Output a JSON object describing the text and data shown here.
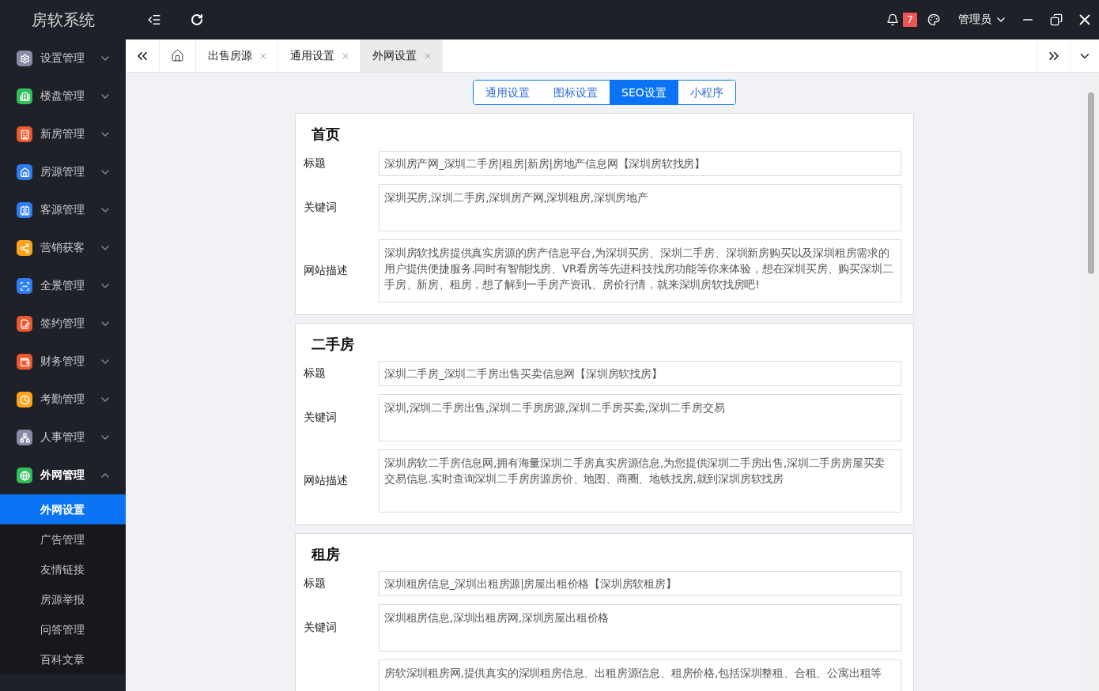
{
  "header": {
    "logo": "房软系统",
    "notification_count": "7",
    "user": "管理员"
  },
  "sidebar": {
    "items": [
      {
        "label": "设置管理",
        "color": "#8a8aa8",
        "expanded": false
      },
      {
        "label": "楼盘管理",
        "color": "#2fbf5b",
        "expanded": false
      },
      {
        "label": "新房管理",
        "color": "#f0572d",
        "expanded": false
      },
      {
        "label": "房源管理",
        "color": "#2f7df6",
        "expanded": false
      },
      {
        "label": "客源管理",
        "color": "#2f7df6",
        "expanded": false
      },
      {
        "label": "营销获客",
        "color": "#fba41c",
        "expanded": false
      },
      {
        "label": "全景管理",
        "color": "#2f7df6",
        "expanded": false
      },
      {
        "label": "签约管理",
        "color": "#f0572d",
        "expanded": false
      },
      {
        "label": "财务管理",
        "color": "#f0572d",
        "expanded": false
      },
      {
        "label": "考勤管理",
        "color": "#fba41c",
        "expanded": false
      },
      {
        "label": "人事管理",
        "color": "#8a8aa8",
        "expanded": false
      },
      {
        "label": "外网管理",
        "color": "#2fbf5b",
        "expanded": true,
        "children": [
          {
            "label": "外网设置",
            "selected": true
          },
          {
            "label": "广告管理",
            "selected": false
          },
          {
            "label": "友情链接",
            "selected": false
          },
          {
            "label": "房源举报",
            "selected": false
          },
          {
            "label": "问答管理",
            "selected": false
          },
          {
            "label": "百科文章",
            "selected": false
          }
        ]
      }
    ]
  },
  "tabs": [
    {
      "label": "出售房源",
      "selected": false
    },
    {
      "label": "通用设置",
      "selected": false
    },
    {
      "label": "外网设置",
      "selected": true
    }
  ],
  "segments": [
    {
      "label": "通用设置",
      "selected": false
    },
    {
      "label": "图标设置",
      "selected": false
    },
    {
      "label": "SEO设置",
      "selected": true
    },
    {
      "label": "小程序",
      "selected": false
    }
  ],
  "sections": [
    {
      "title": "首页",
      "fields": [
        {
          "kind": "input",
          "label": "标题",
          "value": "深圳房产网_深圳二手房|租房|新房|房地产信息网【深圳房软找房】"
        },
        {
          "kind": "keywords",
          "label": "关键词",
          "value": "深圳买房,深圳二手房,深圳房产网,深圳租房,深圳房地产"
        },
        {
          "kind": "description",
          "label": "网站描述",
          "value": "深圳房软找房提供真实房源的房产信息平台,为深圳买房、深圳二手房、深圳新房购买以及深圳租房需求的用户提供便捷服务.同时有智能找房、VR看房等先进科技找房功能等你来体验，想在深圳买房、购买深圳二手房、新房、租房，想了解到一手房产资讯、房价行情，就来深圳房软找房吧!"
        }
      ]
    },
    {
      "title": "二手房",
      "fields": [
        {
          "kind": "input",
          "label": "标题",
          "value": "深圳二手房_深圳二手房出售买卖信息网【深圳房软找房】"
        },
        {
          "kind": "keywords",
          "label": "关键词",
          "value": "深圳,深圳二手房出售,深圳二手房房源,深圳二手房买卖,深圳二手房交易"
        },
        {
          "kind": "description",
          "label": "网站描述",
          "value": "深圳房软二手房信息网,拥有海量深圳二手房真实房源信息,为您提供深圳二手房出售,深圳二手房房屋买卖交易信息.实时查询深圳二手房房源房价、地图、商圈、地铁找房,就到深圳房软找房"
        }
      ]
    },
    {
      "title": "租房",
      "fields": [
        {
          "kind": "input",
          "label": "标题",
          "value": "深圳租房信息_深圳出租房源|房屋出租价格【深圳房软租房】"
        },
        {
          "kind": "keywords",
          "label": "关键词",
          "value": "深圳租房信息,深圳出租房网,深圳房屋出租价格"
        },
        {
          "kind": "description",
          "value": "房软深圳租房网,提供真实的深圳租房信息、出租房源信息、租房价格,包括深圳整租、合租、公寓出租等"
        }
      ]
    }
  ]
}
